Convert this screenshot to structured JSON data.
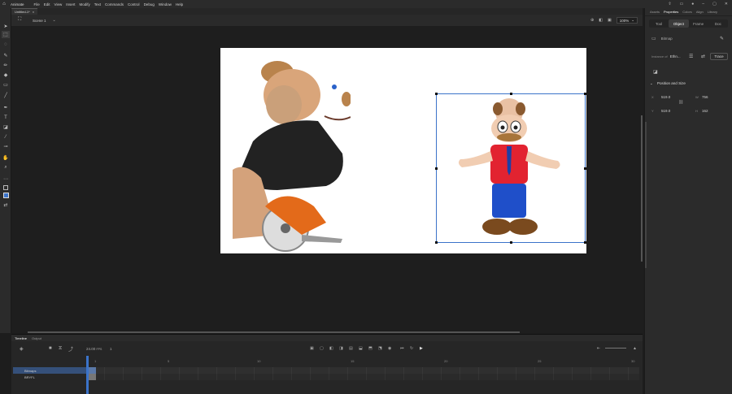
{
  "app": {
    "name": "Animate",
    "logo_icon": "home-icon"
  },
  "menu": [
    "File",
    "Edit",
    "View",
    "Insert",
    "Modify",
    "Text",
    "Commands",
    "Control",
    "Debug",
    "Window",
    "Help"
  ],
  "document": {
    "tab_title": "Untitled-1*"
  },
  "scene": {
    "name": "Scene 1",
    "zoom": "100%"
  },
  "props": {
    "tabs": [
      "Assets",
      "Properties",
      "Colors",
      "Align",
      "Library"
    ],
    "active_tab": "Properties",
    "subtabs": [
      "Tool",
      "Object",
      "Frame",
      "Doc"
    ],
    "active_subtab": "Object",
    "object_type": "Bitmap",
    "instance_of_label": "Instance of",
    "instance_of_value": "Ethn...",
    "trace_label": "Trace",
    "section_title": "Position and Size",
    "x_label": "X",
    "x_value": "519.0",
    "y_label": "Y",
    "y_value": "519.0",
    "w_label": "W",
    "w_value": "756",
    "h_label": "H",
    "h_value": "162"
  },
  "timeline": {
    "tabs": [
      "Timeline",
      "Output"
    ],
    "active_tab": "Timeline",
    "fps": "24.00",
    "fps_unit": "FPS",
    "current_frame": "1",
    "layers": [
      {
        "name": "Bitmaps",
        "selected": true
      },
      {
        "name": "BRYFL",
        "selected": false
      }
    ],
    "ruler": [
      "1",
      "5",
      "10",
      "15",
      "20",
      "25",
      "30"
    ]
  },
  "colors": {
    "accent": "#3b73c9",
    "canvas": "#ffffff",
    "stage": "#1e1e1e"
  }
}
